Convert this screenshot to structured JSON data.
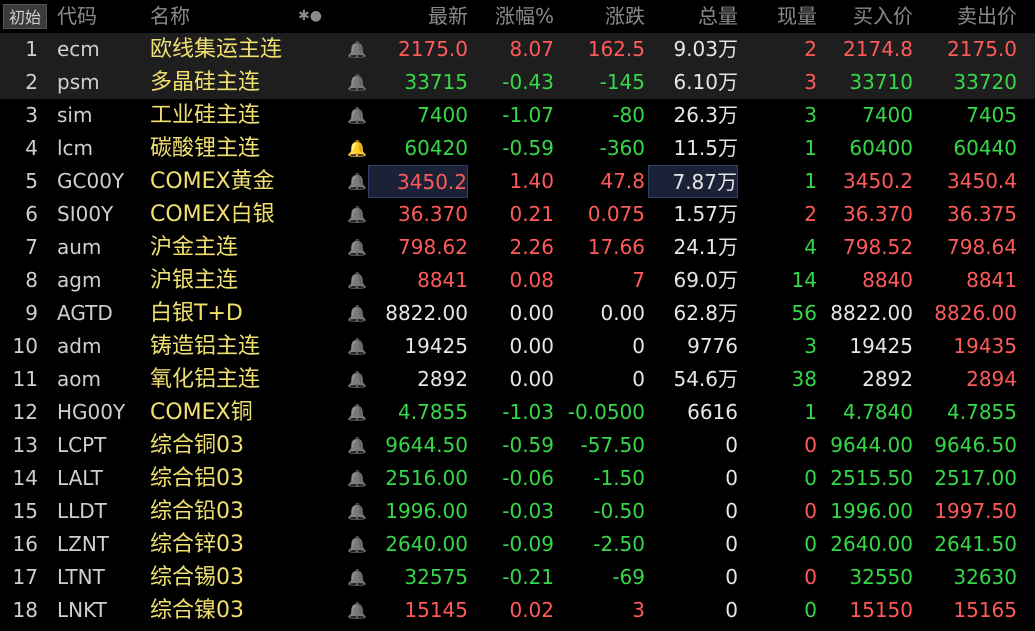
{
  "header": {
    "init_button": "初始",
    "cols": {
      "code": "代码",
      "name": "名称",
      "last": "最新",
      "pct": "涨幅%",
      "chg": "涨跌",
      "vol": "总量",
      "cur": "现量",
      "bid": "买入价",
      "ask": "卖出价"
    },
    "tools_glyphs": "✱●"
  },
  "colors": {
    "up": "#ff5a5a",
    "down": "#36d84a",
    "flat": "#e6e6e6",
    "name": "#f0e070"
  },
  "rows": [
    {
      "idx": "1",
      "code": "ecm",
      "name": "欧线集运主连",
      "bell": "off",
      "last": "2175.0",
      "pct": "8.07",
      "chg": "162.5",
      "vol": "9.03万",
      "cur": "2",
      "bid": "2174.8",
      "ask": "2175.0",
      "c": {
        "last": "red",
        "pct": "red",
        "chg": "red",
        "cur": "red",
        "bid": "red",
        "ask": "red"
      }
    },
    {
      "idx": "2",
      "code": "psm",
      "name": "多晶硅主连",
      "bell": "off",
      "last": "33715",
      "pct": "-0.43",
      "chg": "-145",
      "vol": "6.10万",
      "cur": "3",
      "bid": "33710",
      "ask": "33720",
      "c": {
        "last": "green",
        "pct": "green",
        "chg": "green",
        "cur": "red",
        "bid": "green",
        "ask": "green"
      }
    },
    {
      "idx": "3",
      "code": "sim",
      "name": "工业硅主连",
      "bell": "off",
      "last": "7400",
      "pct": "-1.07",
      "chg": "-80",
      "vol": "26.3万",
      "cur": "3",
      "bid": "7400",
      "ask": "7405",
      "c": {
        "last": "green",
        "pct": "green",
        "chg": "green",
        "cur": "green",
        "bid": "green",
        "ask": "green"
      }
    },
    {
      "idx": "4",
      "code": "lcm",
      "name": "碳酸锂主连",
      "bell": "alert",
      "last": "60420",
      "pct": "-0.59",
      "chg": "-360",
      "vol": "11.5万",
      "cur": "1",
      "bid": "60400",
      "ask": "60440",
      "c": {
        "last": "green",
        "pct": "green",
        "chg": "green",
        "cur": "green",
        "bid": "green",
        "ask": "green"
      }
    },
    {
      "idx": "5",
      "code": "GC00Y",
      "name": "COMEX黄金",
      "bell": "off",
      "last": "3450.2",
      "pct": "1.40",
      "chg": "47.8",
      "vol": "7.87万",
      "cur": "1",
      "bid": "3450.2",
      "ask": "3450.4",
      "c": {
        "last": "red",
        "pct": "red",
        "chg": "red",
        "cur": "green",
        "bid": "red",
        "ask": "red"
      }
    },
    {
      "idx": "6",
      "code": "SI00Y",
      "name": "COMEX白银",
      "bell": "off",
      "last": "36.370",
      "pct": "0.21",
      "chg": "0.075",
      "vol": "1.57万",
      "cur": "2",
      "bid": "36.370",
      "ask": "36.375",
      "c": {
        "last": "red",
        "pct": "red",
        "chg": "red",
        "cur": "red",
        "bid": "red",
        "ask": "red"
      }
    },
    {
      "idx": "7",
      "code": "aum",
      "name": "沪金主连",
      "bell": "off",
      "last": "798.62",
      "pct": "2.26",
      "chg": "17.66",
      "vol": "24.1万",
      "cur": "4",
      "bid": "798.52",
      "ask": "798.64",
      "c": {
        "last": "red",
        "pct": "red",
        "chg": "red",
        "cur": "green",
        "bid": "red",
        "ask": "red"
      }
    },
    {
      "idx": "8",
      "code": "agm",
      "name": "沪银主连",
      "bell": "off",
      "last": "8841",
      "pct": "0.08",
      "chg": "7",
      "vol": "69.0万",
      "cur": "14",
      "bid": "8840",
      "ask": "8841",
      "c": {
        "last": "red",
        "pct": "red",
        "chg": "red",
        "cur": "green",
        "bid": "red",
        "ask": "red"
      }
    },
    {
      "idx": "9",
      "code": "AGTD",
      "name": "白银T+D",
      "bell": "off",
      "last": "8822.00",
      "pct": "0.00",
      "chg": "0.00",
      "vol": "62.8万",
      "cur": "56",
      "bid": "8822.00",
      "ask": "8826.00",
      "c": {
        "last": "white",
        "pct": "white",
        "chg": "white",
        "cur": "green",
        "bid": "white",
        "ask": "red"
      }
    },
    {
      "idx": "10",
      "code": "adm",
      "name": "铸造铝主连",
      "bell": "off",
      "last": "19425",
      "pct": "0.00",
      "chg": "0",
      "vol": "9776",
      "cur": "3",
      "bid": "19425",
      "ask": "19435",
      "c": {
        "last": "white",
        "pct": "white",
        "chg": "white",
        "cur": "green",
        "bid": "white",
        "ask": "red"
      }
    },
    {
      "idx": "11",
      "code": "aom",
      "name": "氧化铝主连",
      "bell": "off",
      "last": "2892",
      "pct": "0.00",
      "chg": "0",
      "vol": "54.6万",
      "cur": "38",
      "bid": "2892",
      "ask": "2894",
      "c": {
        "last": "white",
        "pct": "white",
        "chg": "white",
        "cur": "green",
        "bid": "white",
        "ask": "red"
      }
    },
    {
      "idx": "12",
      "code": "HG00Y",
      "name": "COMEX铜",
      "bell": "off",
      "last": "4.7855",
      "pct": "-1.03",
      "chg": "-0.0500",
      "vol": "6616",
      "cur": "1",
      "bid": "4.7840",
      "ask": "4.7855",
      "c": {
        "last": "green",
        "pct": "green",
        "chg": "green",
        "cur": "green",
        "bid": "green",
        "ask": "green"
      }
    },
    {
      "idx": "13",
      "code": "LCPT",
      "name": "综合铜03",
      "bell": "off",
      "last": "9644.50",
      "pct": "-0.59",
      "chg": "-57.50",
      "vol": "0",
      "cur": "0",
      "bid": "9644.00",
      "ask": "9646.50",
      "c": {
        "last": "green",
        "pct": "green",
        "chg": "green",
        "cur": "red",
        "bid": "green",
        "ask": "green"
      }
    },
    {
      "idx": "14",
      "code": "LALT",
      "name": "综合铝03",
      "bell": "off",
      "last": "2516.00",
      "pct": "-0.06",
      "chg": "-1.50",
      "vol": "0",
      "cur": "0",
      "bid": "2515.50",
      "ask": "2517.00",
      "c": {
        "last": "green",
        "pct": "green",
        "chg": "green",
        "cur": "green",
        "bid": "green",
        "ask": "green"
      }
    },
    {
      "idx": "15",
      "code": "LLDT",
      "name": "综合铅03",
      "bell": "off",
      "last": "1996.00",
      "pct": "-0.03",
      "chg": "-0.50",
      "vol": "0",
      "cur": "0",
      "bid": "1996.00",
      "ask": "1997.50",
      "c": {
        "last": "green",
        "pct": "green",
        "chg": "green",
        "cur": "red",
        "bid": "green",
        "ask": "red"
      }
    },
    {
      "idx": "16",
      "code": "LZNT",
      "name": "综合锌03",
      "bell": "off",
      "last": "2640.00",
      "pct": "-0.09",
      "chg": "-2.50",
      "vol": "0",
      "cur": "0",
      "bid": "2640.00",
      "ask": "2641.50",
      "c": {
        "last": "green",
        "pct": "green",
        "chg": "green",
        "cur": "green",
        "bid": "green",
        "ask": "green"
      }
    },
    {
      "idx": "17",
      "code": "LTNT",
      "name": "综合锡03",
      "bell": "off",
      "last": "32575",
      "pct": "-0.21",
      "chg": "-69",
      "vol": "0",
      "cur": "0",
      "bid": "32550",
      "ask": "32630",
      "c": {
        "last": "green",
        "pct": "green",
        "chg": "green",
        "cur": "red",
        "bid": "green",
        "ask": "green"
      }
    },
    {
      "idx": "18",
      "code": "LNKT",
      "name": "综合镍03",
      "bell": "off",
      "last": "15145",
      "pct": "0.02",
      "chg": "3",
      "vol": "0",
      "cur": "0",
      "bid": "15150",
      "ask": "15165",
      "c": {
        "last": "red",
        "pct": "red",
        "chg": "red",
        "cur": "green",
        "bid": "red",
        "ask": "red"
      }
    }
  ]
}
